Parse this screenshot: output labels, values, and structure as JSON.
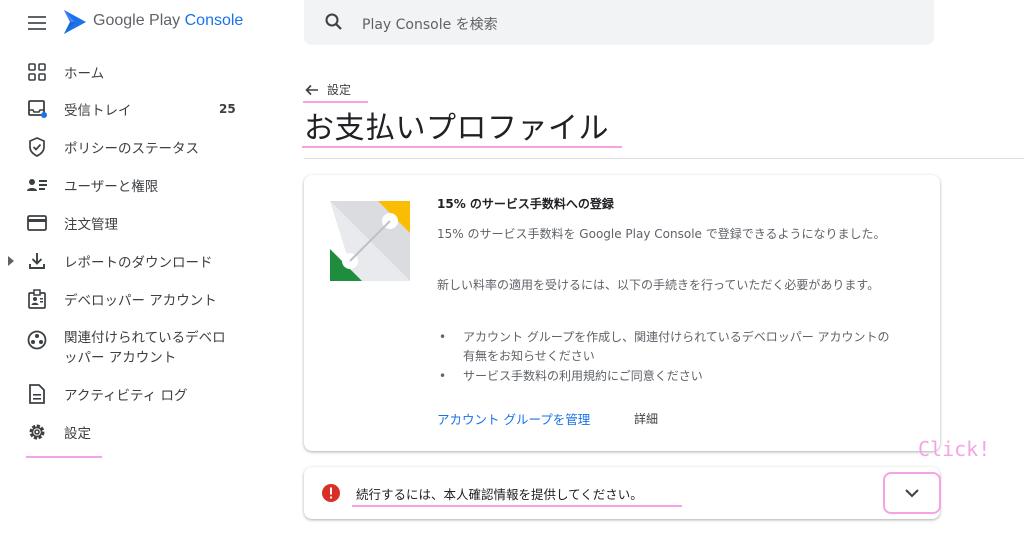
{
  "header": {
    "brand_google_play": "Google Play",
    "brand_console": "Console",
    "search_placeholder": "Play Console を検索"
  },
  "sidebar": {
    "items": [
      {
        "label": "ホーム",
        "icon": "grid-icon"
      },
      {
        "label": "受信トレイ",
        "icon": "inbox-icon",
        "count": "25"
      },
      {
        "label": "ポリシーのステータス",
        "icon": "shield-check-icon"
      },
      {
        "label": "ユーザーと権限",
        "icon": "users-list-icon"
      },
      {
        "label": "注文管理",
        "icon": "credit-card-icon"
      },
      {
        "label": "レポートのダウンロード",
        "icon": "download-icon"
      },
      {
        "label": "デベロッパー アカウント",
        "icon": "developer-badge-icon"
      },
      {
        "label_line1": "関連付けられているデベロ",
        "label_line2": "ッパー アカウント",
        "icon": "linked-accounts-icon"
      },
      {
        "label": "アクティビティ ログ",
        "icon": "document-icon"
      },
      {
        "label": "設定",
        "icon": "gear-icon"
      }
    ]
  },
  "main": {
    "back_label": "設定",
    "page_title": "お支払いプロファイル",
    "card": {
      "title": "15% のサービス手数料への登録",
      "para1": "15% のサービス手数料を Google Play Console で登録できるようになりました。",
      "para2": "新しい料率の適用を受けるには、以下の手続きを行っていただく必要があります。",
      "bullet1": "アカウント グループを作成し、関連付けられているデベロッパー アカウントの有無をお知らせください",
      "bullet2": "サービス手数料の利用規約にご同意ください",
      "link_manage": "アカウント グループを管理",
      "link_details": "詳細"
    },
    "alert": {
      "text": "続行するには、本人確認情報を提供してください。"
    },
    "annotation_click": "Click!"
  },
  "colors": {
    "accent": "#1a73e8",
    "highlight": "#f6a3e6",
    "error": "#d93025"
  }
}
